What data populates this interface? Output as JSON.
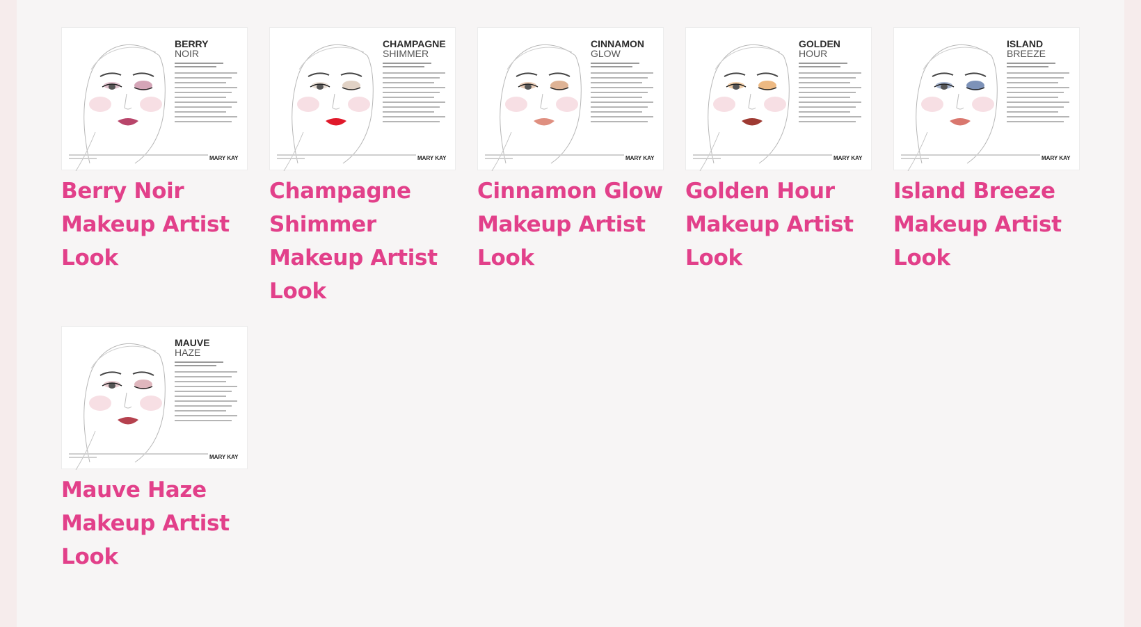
{
  "looks": [
    {
      "title": "Berry Noir Makeup Artist Look",
      "thumb_line1": "BERRY",
      "thumb_line2": "NOIR",
      "brand": "MARY KAY",
      "lip_color": "#b8456a",
      "eye_color": "#c98fa5"
    },
    {
      "title": "Champagne Shimmer Makeup Artist Look",
      "thumb_line1": "CHAMPAGNE",
      "thumb_line2": "SHIMMER",
      "brand": "MARY KAY",
      "lip_color": "#e0182a",
      "eye_color": "#d9c7b6"
    },
    {
      "title": "Cinnamon Glow Makeup Artist Look",
      "thumb_line1": "CINNAMON",
      "thumb_line2": "GLOW",
      "brand": "MARY KAY",
      "lip_color": "#df8f80",
      "eye_color": "#d6a07a"
    },
    {
      "title": "Golden Hour Makeup Artist Look",
      "thumb_line1": "GOLDEN",
      "thumb_line2": "HOUR",
      "brand": "MARY KAY",
      "lip_color": "#9e3a32",
      "eye_color": "#e8a763"
    },
    {
      "title": "Island Breeze Makeup Artist Look",
      "thumb_line1": "ISLAND",
      "thumb_line2": "BREEZE",
      "brand": "MARY KAY",
      "lip_color": "#d9776e",
      "eye_color": "#5d77a6"
    },
    {
      "title": "Mauve Haze Makeup Artist Look",
      "thumb_line1": "MAUVE",
      "thumb_line2": "HAZE",
      "brand": "MARY KAY",
      "lip_color": "#b5414e",
      "eye_color": "#d7a4ad"
    }
  ],
  "colors": {
    "title_pink": "#e2408a",
    "background": "#f7f5f5"
  }
}
